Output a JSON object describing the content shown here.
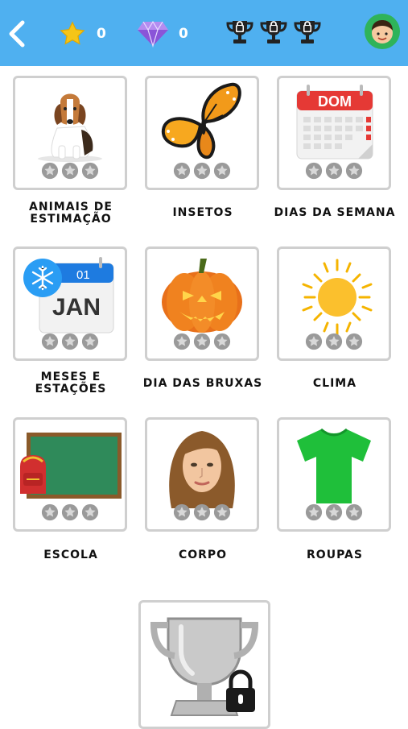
{
  "header": {
    "stars_count": "0",
    "gems_count": "0",
    "colors": {
      "bar": "#4fb0f0",
      "star": "#f5c518",
      "gem": "#a974e6"
    }
  },
  "categories": [
    {
      "label": "ANIMAIS DE ESTIMAÇÃO",
      "icon": "beagle-dog-icon",
      "stars": "0 of 3"
    },
    {
      "label": "INSETOS",
      "icon": "butterfly-icon",
      "stars": "0 of 3"
    },
    {
      "label": "DIAS DA SEMANA",
      "icon": "calendar-icon",
      "calendar_text": "DOM",
      "stars": "0 of 3"
    },
    {
      "label": "MESES E ESTAÇÕES",
      "icon": "month-calendar-icon",
      "day_text": "01",
      "month_text": "JAN",
      "stars": "0 of 3"
    },
    {
      "label": "DIA DAS BRUXAS",
      "icon": "jack-o-lantern-icon",
      "stars": "0 of 3"
    },
    {
      "label": "CLIMA",
      "icon": "sun-icon",
      "stars": "0 of 3"
    },
    {
      "label": "ESCOLA",
      "icon": "chalkboard-backpack-icon",
      "stars": "0 of 3"
    },
    {
      "label": "CORPO",
      "icon": "woman-face-icon",
      "stars": "0 of 3"
    },
    {
      "label": "ROUPAS",
      "icon": "green-tshirt-icon",
      "stars": "0 of 3"
    }
  ],
  "locked_card": {
    "icon": "locked-trophy-icon"
  }
}
